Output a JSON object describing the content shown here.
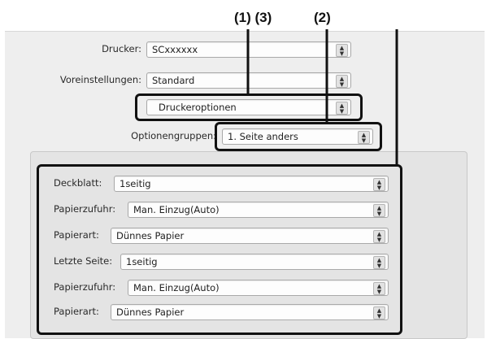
{
  "callouts": {
    "c1_3": "(1) (3)",
    "c2": "(2)"
  },
  "header": {
    "printer_label": "Drucker:",
    "printer_value": "SCxxxxxx",
    "presets_label": "Voreinstellungen:",
    "presets_value": "Standard",
    "panel_value": "Druckeroptionen",
    "groups_label": "Optionengruppen:",
    "groups_value": "1. Seite anders"
  },
  "options": [
    {
      "label": "Deckblatt:",
      "value": "1seitig"
    },
    {
      "label": "Papierzufuhr:",
      "value": "Man. Einzug(Auto)"
    },
    {
      "label": "Papierart:",
      "value": "Dünnes Papier"
    },
    {
      "label": "Letzte Seite:",
      "value": "1seitig"
    },
    {
      "label": "Papierzufuhr:",
      "value": "Man. Einzug(Auto)"
    },
    {
      "label": "Papierart:",
      "value": "Dünnes Papier"
    }
  ]
}
